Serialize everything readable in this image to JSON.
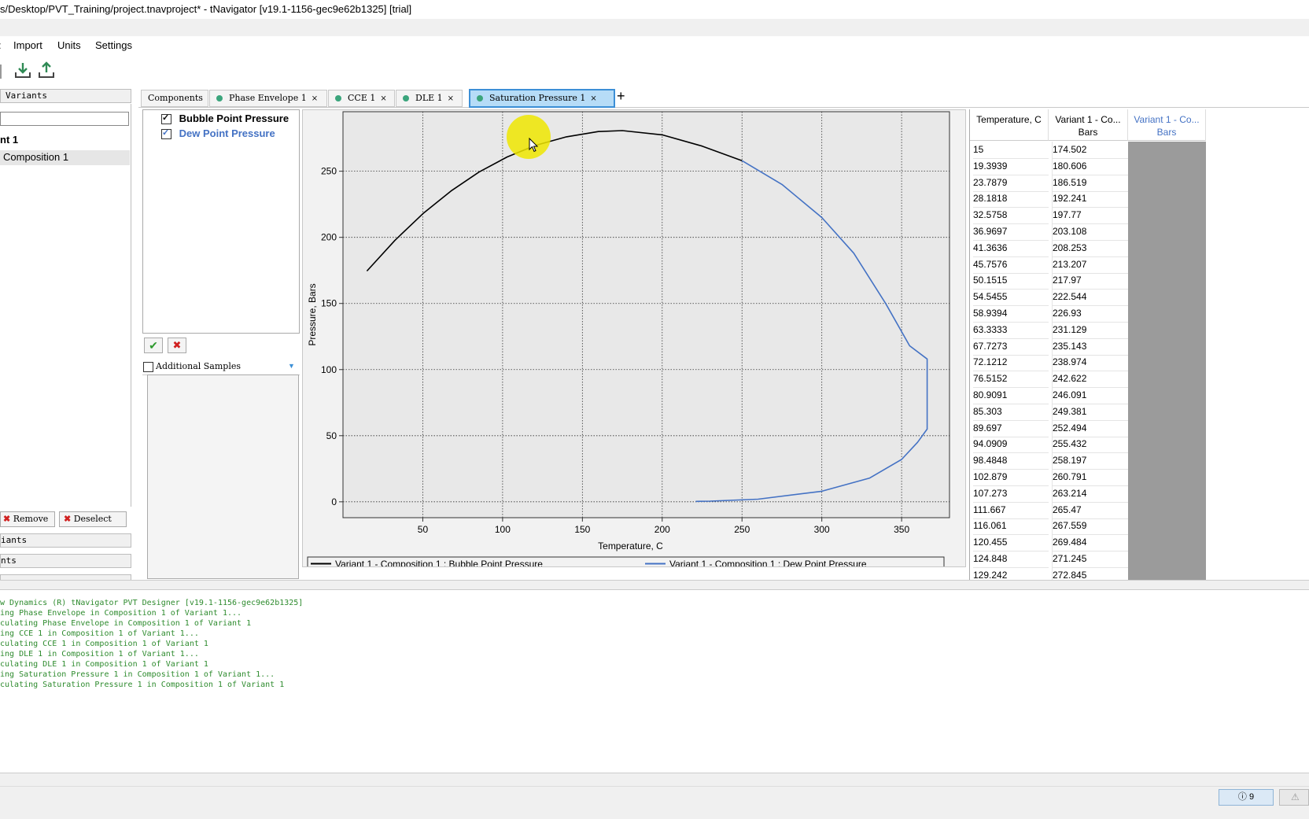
{
  "window": {
    "title": "s/Desktop/PVT_Training/project.tnavproject* - tNavigator [v19.1-1156-gec9e62b1325] [trial]"
  },
  "menu": {
    "items": [
      ":",
      "Import",
      "Units",
      "Settings"
    ]
  },
  "toolbar": {
    "icons": [
      "import-icon",
      "export-icon"
    ]
  },
  "sidebar": {
    "variants_header": "Variants",
    "tree": [
      "nt 1",
      "Composition 1"
    ],
    "remove_label": "Remove",
    "deselect_label": "Deselect",
    "section2": "iants",
    "section3": "nts"
  },
  "tabs": [
    {
      "label": "Components",
      "dot": false,
      "close": false,
      "active": false
    },
    {
      "label": "Phase Envelope 1",
      "dot": true,
      "close": true,
      "active": false
    },
    {
      "label": "CCE 1",
      "dot": true,
      "close": true,
      "active": false
    },
    {
      "label": "DLE 1",
      "dot": true,
      "close": true,
      "active": false
    },
    {
      "label": "Saturation Pressure 1",
      "dot": true,
      "close": true,
      "active": true
    }
  ],
  "add_tab_label": "+",
  "series_list": [
    {
      "label": "Bubble Point Pressure",
      "checked": true,
      "color": "#000000"
    },
    {
      "label": "Dew Point Pressure",
      "checked": true,
      "color": "#4472c4"
    }
  ],
  "additional_samples_label": "Additional Samples",
  "chart_data": {
    "type": "line",
    "xlabel": "Temperature, C",
    "ylabel": "Pressure, Bars",
    "xlim": [
      0,
      380
    ],
    "ylim": [
      -12,
      295
    ],
    "xticks": [
      50,
      100,
      150,
      200,
      250,
      300,
      350
    ],
    "yticks": [
      0,
      50,
      100,
      150,
      200,
      250
    ],
    "grid": true,
    "legend_position": "bottom",
    "series": [
      {
        "name": "Variant 1 - Composition 1 : Bubble Point Pressure",
        "color": "#000000",
        "points": [
          [
            15,
            174.5
          ],
          [
            32.58,
            197.8
          ],
          [
            50.15,
            218.0
          ],
          [
            67.73,
            235.1
          ],
          [
            85.3,
            249.4
          ],
          [
            102.88,
            260.8
          ],
          [
            120.46,
            269.5
          ],
          [
            140,
            276
          ],
          [
            160,
            280
          ],
          [
            175,
            280.7
          ],
          [
            200,
            277.5
          ],
          [
            225,
            269
          ],
          [
            250,
            258
          ]
        ]
      },
      {
        "name": "Variant 1 - Composition 1 : Dew Point Pressure",
        "color": "#4472c4",
        "points": [
          [
            250,
            258
          ],
          [
            275,
            240
          ],
          [
            300,
            215
          ],
          [
            320,
            188
          ],
          [
            340,
            150
          ],
          [
            355,
            118
          ],
          [
            366,
            108
          ],
          [
            366,
            55
          ],
          [
            360,
            45
          ],
          [
            350,
            32
          ],
          [
            330,
            18
          ],
          [
            300,
            8
          ],
          [
            260,
            2
          ],
          [
            230,
            0.5
          ],
          [
            221,
            0.3
          ]
        ]
      }
    ]
  },
  "table": {
    "headers": [
      "Temperature, C",
      "Variant 1 - Co... Bars",
      "Variant 1 - Co... Bars"
    ],
    "rows": [
      [
        "15",
        "174.502"
      ],
      [
        "19.3939",
        "180.606"
      ],
      [
        "23.7879",
        "186.519"
      ],
      [
        "28.1818",
        "192.241"
      ],
      [
        "32.5758",
        "197.77"
      ],
      [
        "36.9697",
        "203.108"
      ],
      [
        "41.3636",
        "208.253"
      ],
      [
        "45.7576",
        "213.207"
      ],
      [
        "50.1515",
        "217.97"
      ],
      [
        "54.5455",
        "222.544"
      ],
      [
        "58.9394",
        "226.93"
      ],
      [
        "63.3333",
        "231.129"
      ],
      [
        "67.7273",
        "235.143"
      ],
      [
        "72.1212",
        "238.974"
      ],
      [
        "76.5152",
        "242.622"
      ],
      [
        "80.9091",
        "246.091"
      ],
      [
        "85.303",
        "249.381"
      ],
      [
        "89.697",
        "252.494"
      ],
      [
        "94.0909",
        "255.432"
      ],
      [
        "98.4848",
        "258.197"
      ],
      [
        "102.879",
        "260.791"
      ],
      [
        "107.273",
        "263.214"
      ],
      [
        "111.667",
        "265.47"
      ],
      [
        "116.061",
        "267.559"
      ],
      [
        "120.455",
        "269.484"
      ],
      [
        "124.848",
        "271.245"
      ],
      [
        "129.242",
        "272.845"
      ]
    ]
  },
  "log_lines": [
    "w Dynamics (R) tNavigator PVT Designer [v19.1-1156-gec9e62b1325]",
    "ing Phase Envelope in Composition 1 of Variant 1...",
    "culating Phase Envelope in Composition 1 of Variant 1",
    "ing CCE 1 in Composition 1 of Variant 1...",
    "culating CCE 1 in Composition 1 of Variant 1",
    "ing DLE 1 in Composition 1 of Variant 1...",
    "culating DLE 1 in Composition 1 of Variant 1",
    "ing Saturation Pressure 1 in Composition 1 of Variant 1...",
    "culating Saturation Pressure 1 in Composition 1 of Variant 1"
  ],
  "status": {
    "info_count": "9"
  }
}
